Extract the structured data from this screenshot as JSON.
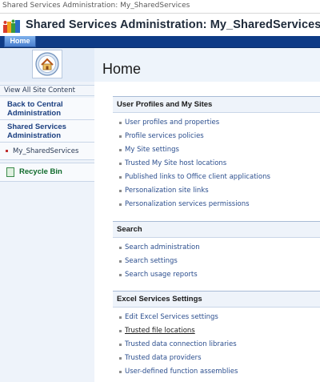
{
  "window": {
    "title": "Shared Services Administration: My_SharedServices"
  },
  "header": {
    "site_title": "Shared Services Administration: My_SharedServices"
  },
  "topnav": {
    "home_tab": "Home"
  },
  "page": {
    "title": "Home"
  },
  "sidebar": {
    "view_all": "View All Site Content",
    "back_to_central": "Back to Central Administration",
    "shared_services": "Shared Services Administration",
    "current_ssp": "My_SharedServices",
    "recycle_bin": "Recycle Bin"
  },
  "sections": [
    {
      "title": "User Profiles and My Sites",
      "links": [
        "User profiles and properties",
        "Profile services policies",
        "My Site settings",
        "Trusted My Site host locations",
        "Published links to Office client applications",
        "Personalization site links",
        "Personalization services permissions"
      ]
    },
    {
      "title": "Search",
      "links": [
        "Search administration",
        "Search settings",
        "Search usage reports"
      ]
    },
    {
      "title": "Excel Services Settings",
      "links": [
        "Edit Excel Services settings",
        "Trusted file locations",
        "Trusted data connection libraries",
        "Trusted data providers",
        "User-defined function assemblies"
      ]
    }
  ],
  "colors": {
    "nav_bar": "#0e3b86",
    "home_tab": "#4a7fcf",
    "link": "#2b4e8e",
    "sidebar_bg": "#eef3fa",
    "recycle_text": "#0f6a2a"
  },
  "icons": {
    "site_logo": "sharepoint-logo-icon",
    "home": "home-icon",
    "recycle": "recycle-bin-icon"
  }
}
